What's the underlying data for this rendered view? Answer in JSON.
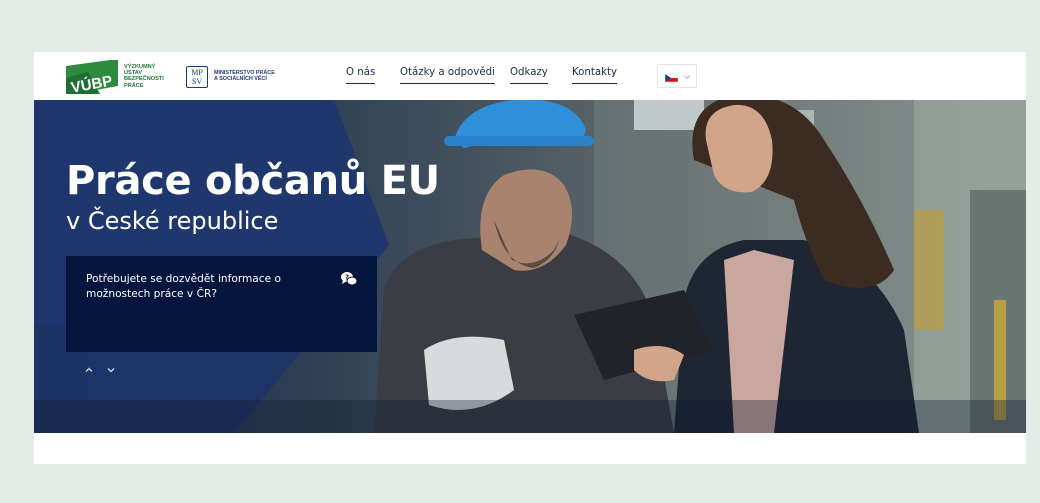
{
  "header": {
    "vubp": {
      "mark_text": "VÚBP",
      "lines": [
        "VÝZKUMNÝ",
        "ÚSTAV",
        "BEZPEČNOSTI",
        "PRÁCE"
      ]
    },
    "mpsv": {
      "mark_text_top": "MP",
      "mark_text_bottom": "SV",
      "lines": [
        "MINISTERSTVO PRÁCE",
        "A SOCIÁLNÍCH VĚCÍ"
      ]
    },
    "nav": [
      {
        "label": "O nás"
      },
      {
        "label": "Otázky a odpovědi"
      },
      {
        "label": "Odkazy"
      },
      {
        "label": "Kontakty"
      }
    ],
    "language": {
      "flag_icon": "czech-flag-icon"
    }
  },
  "hero": {
    "title": "Práce občanů EU",
    "subtitle": "v České republice",
    "question": "Potřebujete se dozvědět informace o možnostech práce v ČR?",
    "chat_icon": "chat-bubbles-icon"
  },
  "colors": {
    "brand_green": "#1f7a39",
    "ministry_blue": "#1d3a78",
    "hero_panel": "#04163e",
    "nav_text": "#1c2a4a",
    "background": "#e4ebe6"
  }
}
